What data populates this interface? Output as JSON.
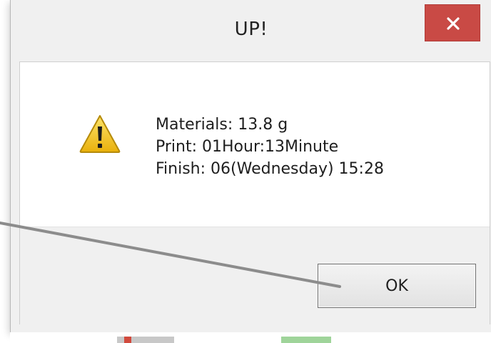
{
  "dialog": {
    "title": "UP!",
    "close_glyph": "×",
    "message_lines": [
      "Materials: 13.8 g",
      "Print: 01Hour:13Minute",
      "Finish: 06(Wednesday) 15:28"
    ],
    "ok_label": "OK",
    "icon": "warning-icon"
  },
  "colors": {
    "close_button": "#c94a45",
    "warning_yellow": "#f2c318",
    "pointer_line": "#8c8c8c"
  }
}
